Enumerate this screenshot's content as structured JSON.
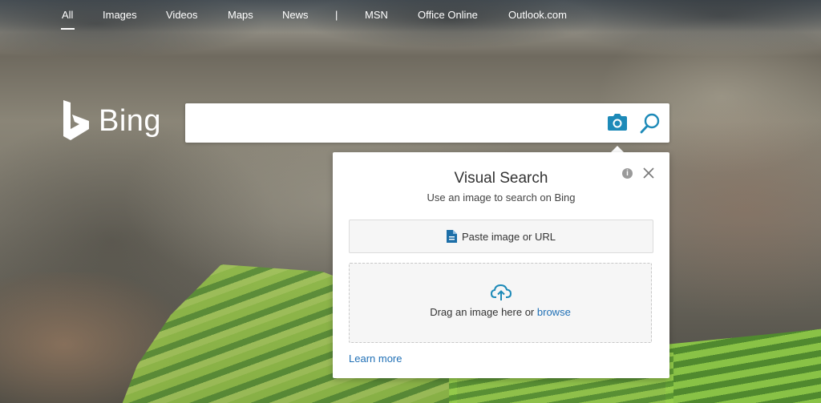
{
  "nav": {
    "items": [
      {
        "label": "All",
        "active": true
      },
      {
        "label": "Images"
      },
      {
        "label": "Videos"
      },
      {
        "label": "Maps"
      },
      {
        "label": "News"
      },
      {
        "label": "MSN"
      },
      {
        "label": "Office Online"
      },
      {
        "label": "Outlook.com"
      }
    ],
    "separator": "|"
  },
  "logo": {
    "text": "Bing",
    "icon": "bing-logo-icon"
  },
  "search": {
    "value": "",
    "placeholder": "",
    "camera_icon": "camera-icon",
    "search_icon": "search-icon"
  },
  "visual_search": {
    "title": "Visual Search",
    "subtitle": "Use an image to search on Bing",
    "info_icon": "info-icon",
    "info_glyph": "i",
    "close_icon": "close-icon",
    "paste_label": "Paste image or URL",
    "paste_icon": "document-icon",
    "drop_text": "Drag an image here or",
    "browse_label": "browse",
    "upload_icon": "cloud-upload-icon",
    "learn_more": "Learn more"
  },
  "colors": {
    "accent": "#1f6fb5",
    "icon_blue": "#1d8ab8",
    "panel_bg": "#ffffff",
    "field_bg": "#f6f6f6"
  }
}
